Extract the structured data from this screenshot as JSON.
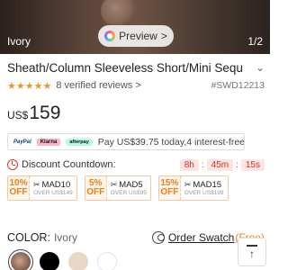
{
  "hero": {
    "color_name": "Ivory",
    "counter": "1/2",
    "preview_label": "Preview",
    "preview_chevron": ">"
  },
  "product": {
    "title": "Sheath/Column Sleeveless Short/Mini Sequ",
    "title_chevron": "⌄",
    "stars": "★★★★★",
    "reviews": "8 verified reviews",
    "reviews_chevron": ">",
    "sku": "#SWD12213",
    "price_currency": "US$",
    "price_amount": "159"
  },
  "pay": {
    "paypal": "PayPal",
    "klarna": "Klarna",
    "afterpay": "afterpay",
    "text": "Pay US$39.75 today,4 interest-free"
  },
  "countdown": {
    "label": "Discount Countdown:",
    "hours": "8h",
    "minutes": "45m",
    "seconds": "15s",
    "sep": ":"
  },
  "coupons": [
    {
      "pct": "10%",
      "off": "OFF",
      "code": "MAD10",
      "cond": "OVER US$149"
    },
    {
      "pct": "5%",
      "off": "OFF",
      "code": "MAD5",
      "cond": "OVER US$95"
    },
    {
      "pct": "15%",
      "off": "OFF",
      "code": "MAD15",
      "cond": "OVER US$199"
    }
  ],
  "color": {
    "label": "COLOR:",
    "value": "Ivory",
    "swatch_link": "Order Swatch",
    "swatch_free": "(Free)"
  },
  "icons": {
    "scissors": "✂",
    "back_to_top": "↑"
  }
}
